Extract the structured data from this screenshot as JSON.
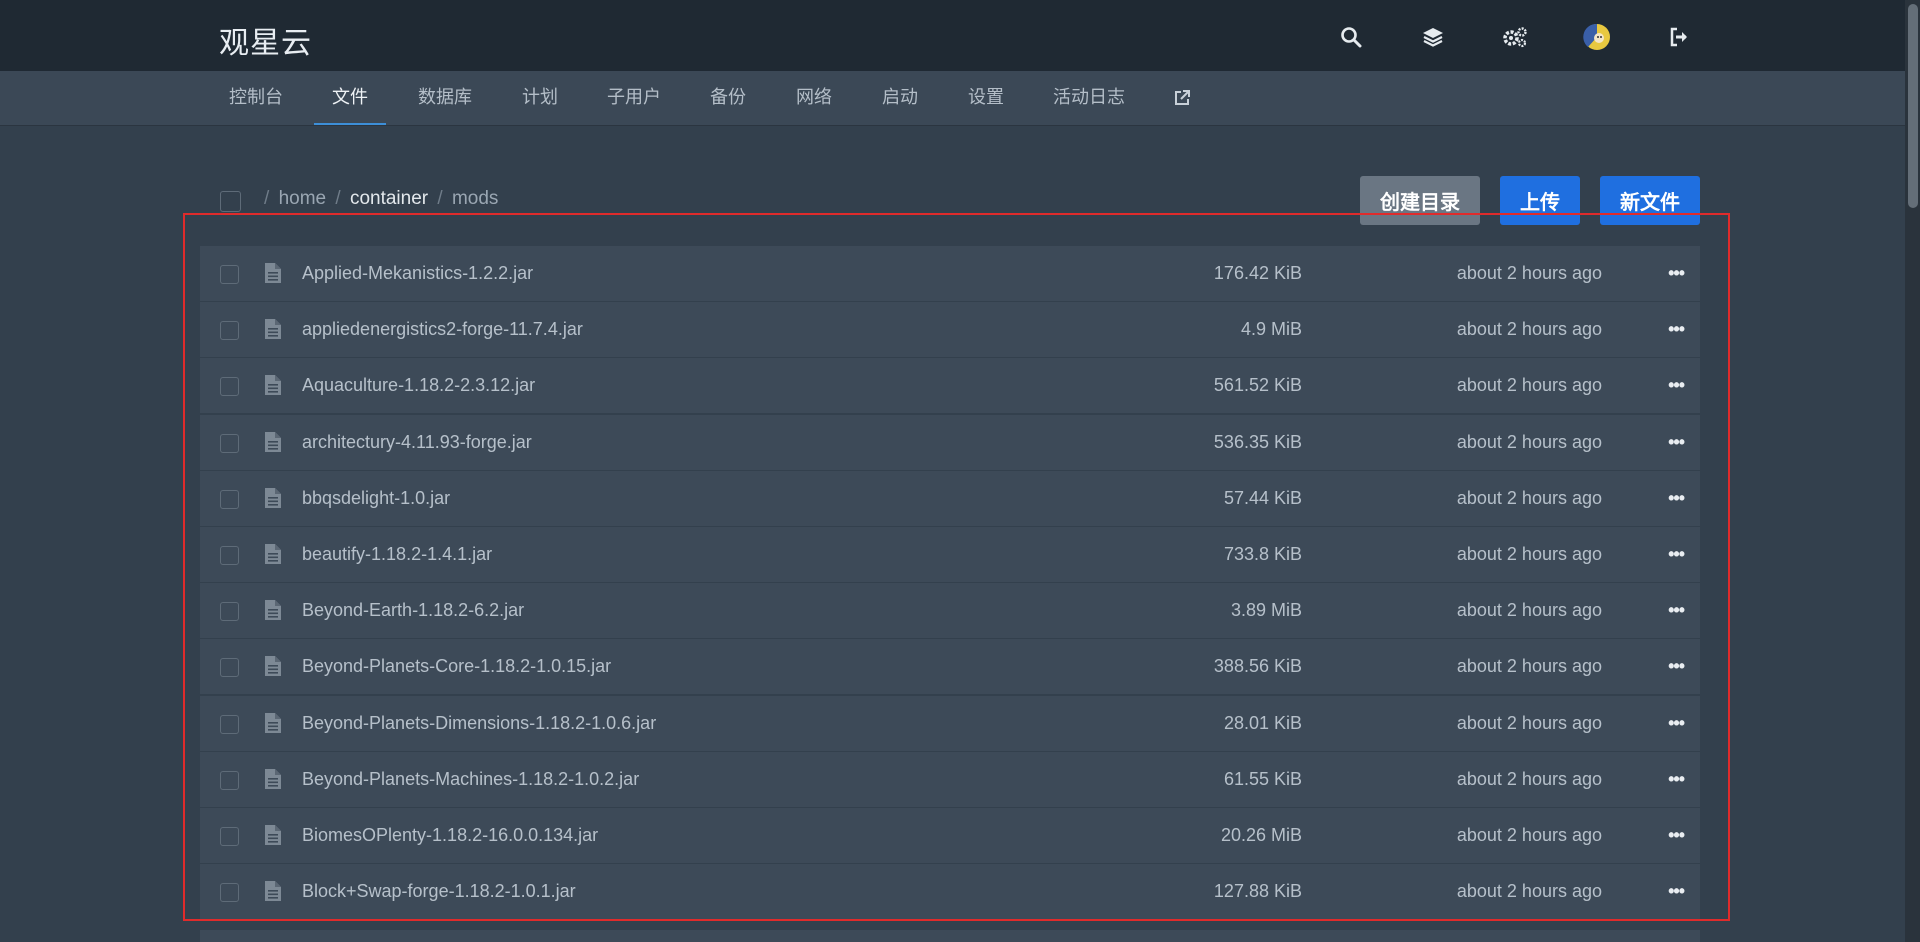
{
  "app": {
    "brand": "观星云"
  },
  "top_icons": [
    "search-icon",
    "layers-icon",
    "settings-cogs-icon",
    "avatar",
    "logout-icon"
  ],
  "nav": {
    "items": [
      {
        "label": "控制台"
      },
      {
        "label": "文件",
        "active": true
      },
      {
        "label": "数据库"
      },
      {
        "label": "计划"
      },
      {
        "label": "子用户"
      },
      {
        "label": "备份"
      },
      {
        "label": "网络"
      },
      {
        "label": "启动"
      },
      {
        "label": "设置"
      },
      {
        "label": "活动日志"
      }
    ],
    "external_icon": "external-link-icon"
  },
  "breadcrumb": {
    "separator": "/",
    "parts": [
      "home",
      "container",
      "mods"
    ]
  },
  "actions": {
    "create_dir": "创建目录",
    "upload": "上传",
    "new_file": "新文件"
  },
  "files": [
    {
      "name": "Applied-Mekanistics-1.2.2.jar",
      "size": "176.42 KiB",
      "modified": "about 2 hours ago"
    },
    {
      "name": "appliedenergistics2-forge-11.7.4.jar",
      "size": "4.9 MiB",
      "modified": "about 2 hours ago"
    },
    {
      "name": "Aquaculture-1.18.2-2.3.12.jar",
      "size": "561.52 KiB",
      "modified": "about 2 hours ago"
    },
    {
      "name": "architectury-4.11.93-forge.jar",
      "size": "536.35 KiB",
      "modified": "about 2 hours ago"
    },
    {
      "name": "bbqsdelight-1.0.jar",
      "size": "57.44 KiB",
      "modified": "about 2 hours ago"
    },
    {
      "name": "beautify-1.18.2-1.4.1.jar",
      "size": "733.8 KiB",
      "modified": "about 2 hours ago"
    },
    {
      "name": "Beyond-Earth-1.18.2-6.2.jar",
      "size": "3.89 MiB",
      "modified": "about 2 hours ago"
    },
    {
      "name": "Beyond-Planets-Core-1.18.2-1.0.15.jar",
      "size": "388.56 KiB",
      "modified": "about 2 hours ago"
    },
    {
      "name": "Beyond-Planets-Dimensions-1.18.2-1.0.6.jar",
      "size": "28.01 KiB",
      "modified": "about 2 hours ago"
    },
    {
      "name": "Beyond-Planets-Machines-1.18.2-1.0.2.jar",
      "size": "61.55 KiB",
      "modified": "about 2 hours ago"
    },
    {
      "name": "BiomesOPlenty-1.18.2-16.0.0.134.jar",
      "size": "20.26 MiB",
      "modified": "about 2 hours ago"
    },
    {
      "name": "Block+Swap-forge-1.18.2-1.0.1.jar",
      "size": "127.88 KiB",
      "modified": "about 2 hours ago"
    }
  ],
  "row_menu_label": "•••",
  "colors": {
    "accent": "#1f6fe0",
    "highlight_box": "#e02b2b",
    "topbar": "#1f2933",
    "background": "#33404d"
  }
}
